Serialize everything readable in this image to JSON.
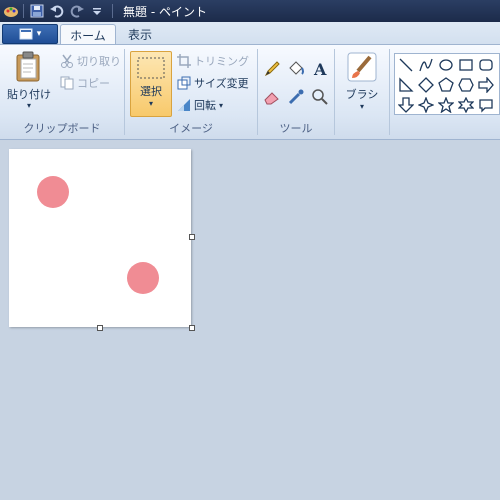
{
  "titlebar": {
    "title": "無題 - ペイント",
    "icons": [
      "paint-app-icon",
      "save-icon",
      "undo-icon",
      "redo-icon",
      "customize-quick-access-icon"
    ]
  },
  "tabs": [
    {
      "label": "ホーム",
      "active": true
    },
    {
      "label": "表示",
      "active": false
    }
  ],
  "ribbon": {
    "clipboard": {
      "label": "クリップボード",
      "paste": "貼り付け",
      "cut": "切り取り",
      "copy": "コピー"
    },
    "image": {
      "label": "イメージ",
      "select": "選択",
      "crop": "トリミング",
      "resize": "サイズ変更",
      "rotate": "回転"
    },
    "tools": {
      "label": "ツール",
      "items": [
        "pencil-icon",
        "fill-icon",
        "text-icon",
        "eraser-icon",
        "color-picker-icon",
        "magnifier-icon"
      ]
    },
    "brushes": {
      "label": "ブラシ"
    },
    "shapes": {
      "items": [
        "line-shape",
        "curve-shape",
        "oval-shape",
        "rectangle-shape",
        "rounded-rectangle-shape",
        "triangle-shape",
        "right-triangle-shape",
        "diamond-shape",
        "pentagon-shape",
        "hexagon-shape",
        "right-arrow-shape",
        "left-arrow-shape",
        "down-arrow-shape",
        "four-point-star-shape",
        "five-point-star-shape",
        "six-point-star-shape",
        "callout-shape"
      ]
    }
  },
  "canvas": {
    "background": "#ffffff",
    "dot_color": "#f08c94"
  },
  "colors": {
    "titlebar": "#1c2b4a",
    "workspace": "#c7d3e2",
    "select_button": "#f8d68f"
  }
}
